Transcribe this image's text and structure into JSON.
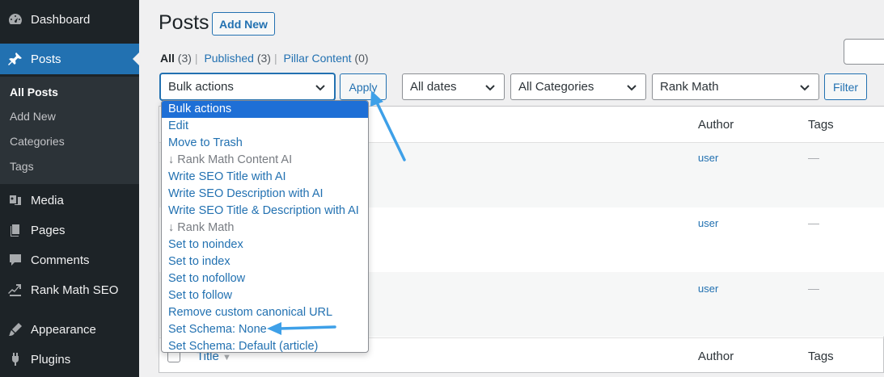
{
  "sidebar": {
    "items": [
      {
        "label": "Dashboard",
        "icon": "dashboard-icon"
      },
      {
        "label": "Posts",
        "icon": "pin-icon",
        "active": true
      },
      {
        "label": "Media",
        "icon": "media-icon"
      },
      {
        "label": "Pages",
        "icon": "pages-icon"
      },
      {
        "label": "Comments",
        "icon": "comments-icon"
      },
      {
        "label": "Rank Math SEO",
        "icon": "rank-math-icon"
      },
      {
        "label": "Appearance",
        "icon": "appearance-icon"
      },
      {
        "label": "Plugins",
        "icon": "plugins-icon"
      }
    ],
    "submenu": [
      "All Posts",
      "Add New",
      "Categories",
      "Tags"
    ]
  },
  "header": {
    "title": "Posts",
    "add_new": "Add New"
  },
  "views": {
    "all": "All",
    "all_count": "(3)",
    "published": "Published",
    "published_count": "(3)",
    "pillar": "Pillar Content",
    "pillar_count": "(0)",
    "separator": "|"
  },
  "filters": {
    "bulk_actions": "Bulk actions",
    "apply": "Apply",
    "dates": "All dates",
    "categories": "All Categories",
    "rank_math": "Rank Math",
    "filter": "Filter"
  },
  "table": {
    "columns": {
      "title": "Title",
      "author": "Author",
      "tags": "Tags"
    },
    "rows": [
      {
        "author": "user",
        "tags": "—"
      },
      {
        "author": "user",
        "tags": "—"
      },
      {
        "author": "user",
        "tags": "—"
      }
    ]
  },
  "bulk_dropdown": {
    "options": [
      {
        "label": "Bulk actions",
        "selected": true
      },
      {
        "label": "Edit"
      },
      {
        "label": "Move to Trash"
      },
      {
        "label": "↓ Rank Math Content AI",
        "group": true
      },
      {
        "label": "Write SEO Title with AI"
      },
      {
        "label": "Write SEO Description with AI"
      },
      {
        "label": "Write SEO Title & Description with AI"
      },
      {
        "label": "↓ Rank Math",
        "group": true
      },
      {
        "label": "Set to noindex"
      },
      {
        "label": "Set to index"
      },
      {
        "label": "Set to nofollow"
      },
      {
        "label": "Set to follow"
      },
      {
        "label": "Remove custom canonical URL"
      },
      {
        "label": "Set Schema: None"
      },
      {
        "label": "Set Schema: Default (article)"
      }
    ]
  },
  "colors": {
    "sidebar_bg": "#1d2327",
    "accent": "#2271b1",
    "selected_option": "#1e6fd6",
    "annotation_arrow": "#3ea0e8"
  }
}
